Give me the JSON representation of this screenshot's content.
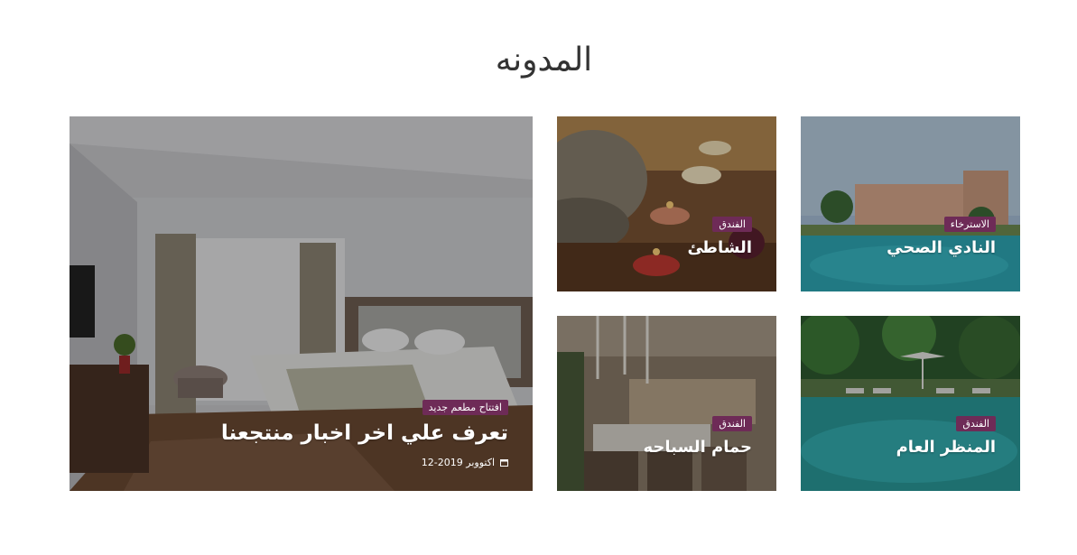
{
  "section": {
    "title": "المدونه"
  },
  "featured": {
    "badge": "افتتاح مطعم جديد",
    "title": "تعرف علي اخر اخبار منتجعنا",
    "date": "اكتووبر 2019-12",
    "date_icon": "calendar-icon"
  },
  "posts": [
    {
      "badge": "الاسترخاء",
      "title": "النادي الصحي"
    },
    {
      "badge": "الفندق",
      "title": "الشاطئ"
    },
    {
      "badge": "الفندق",
      "title": "المنظر العام"
    },
    {
      "badge": "الفندق",
      "title": "حمام السباحه"
    }
  ],
  "colors": {
    "badge_bg": "#6e2b57",
    "title": "#333333",
    "card_text": "#ffffff"
  }
}
